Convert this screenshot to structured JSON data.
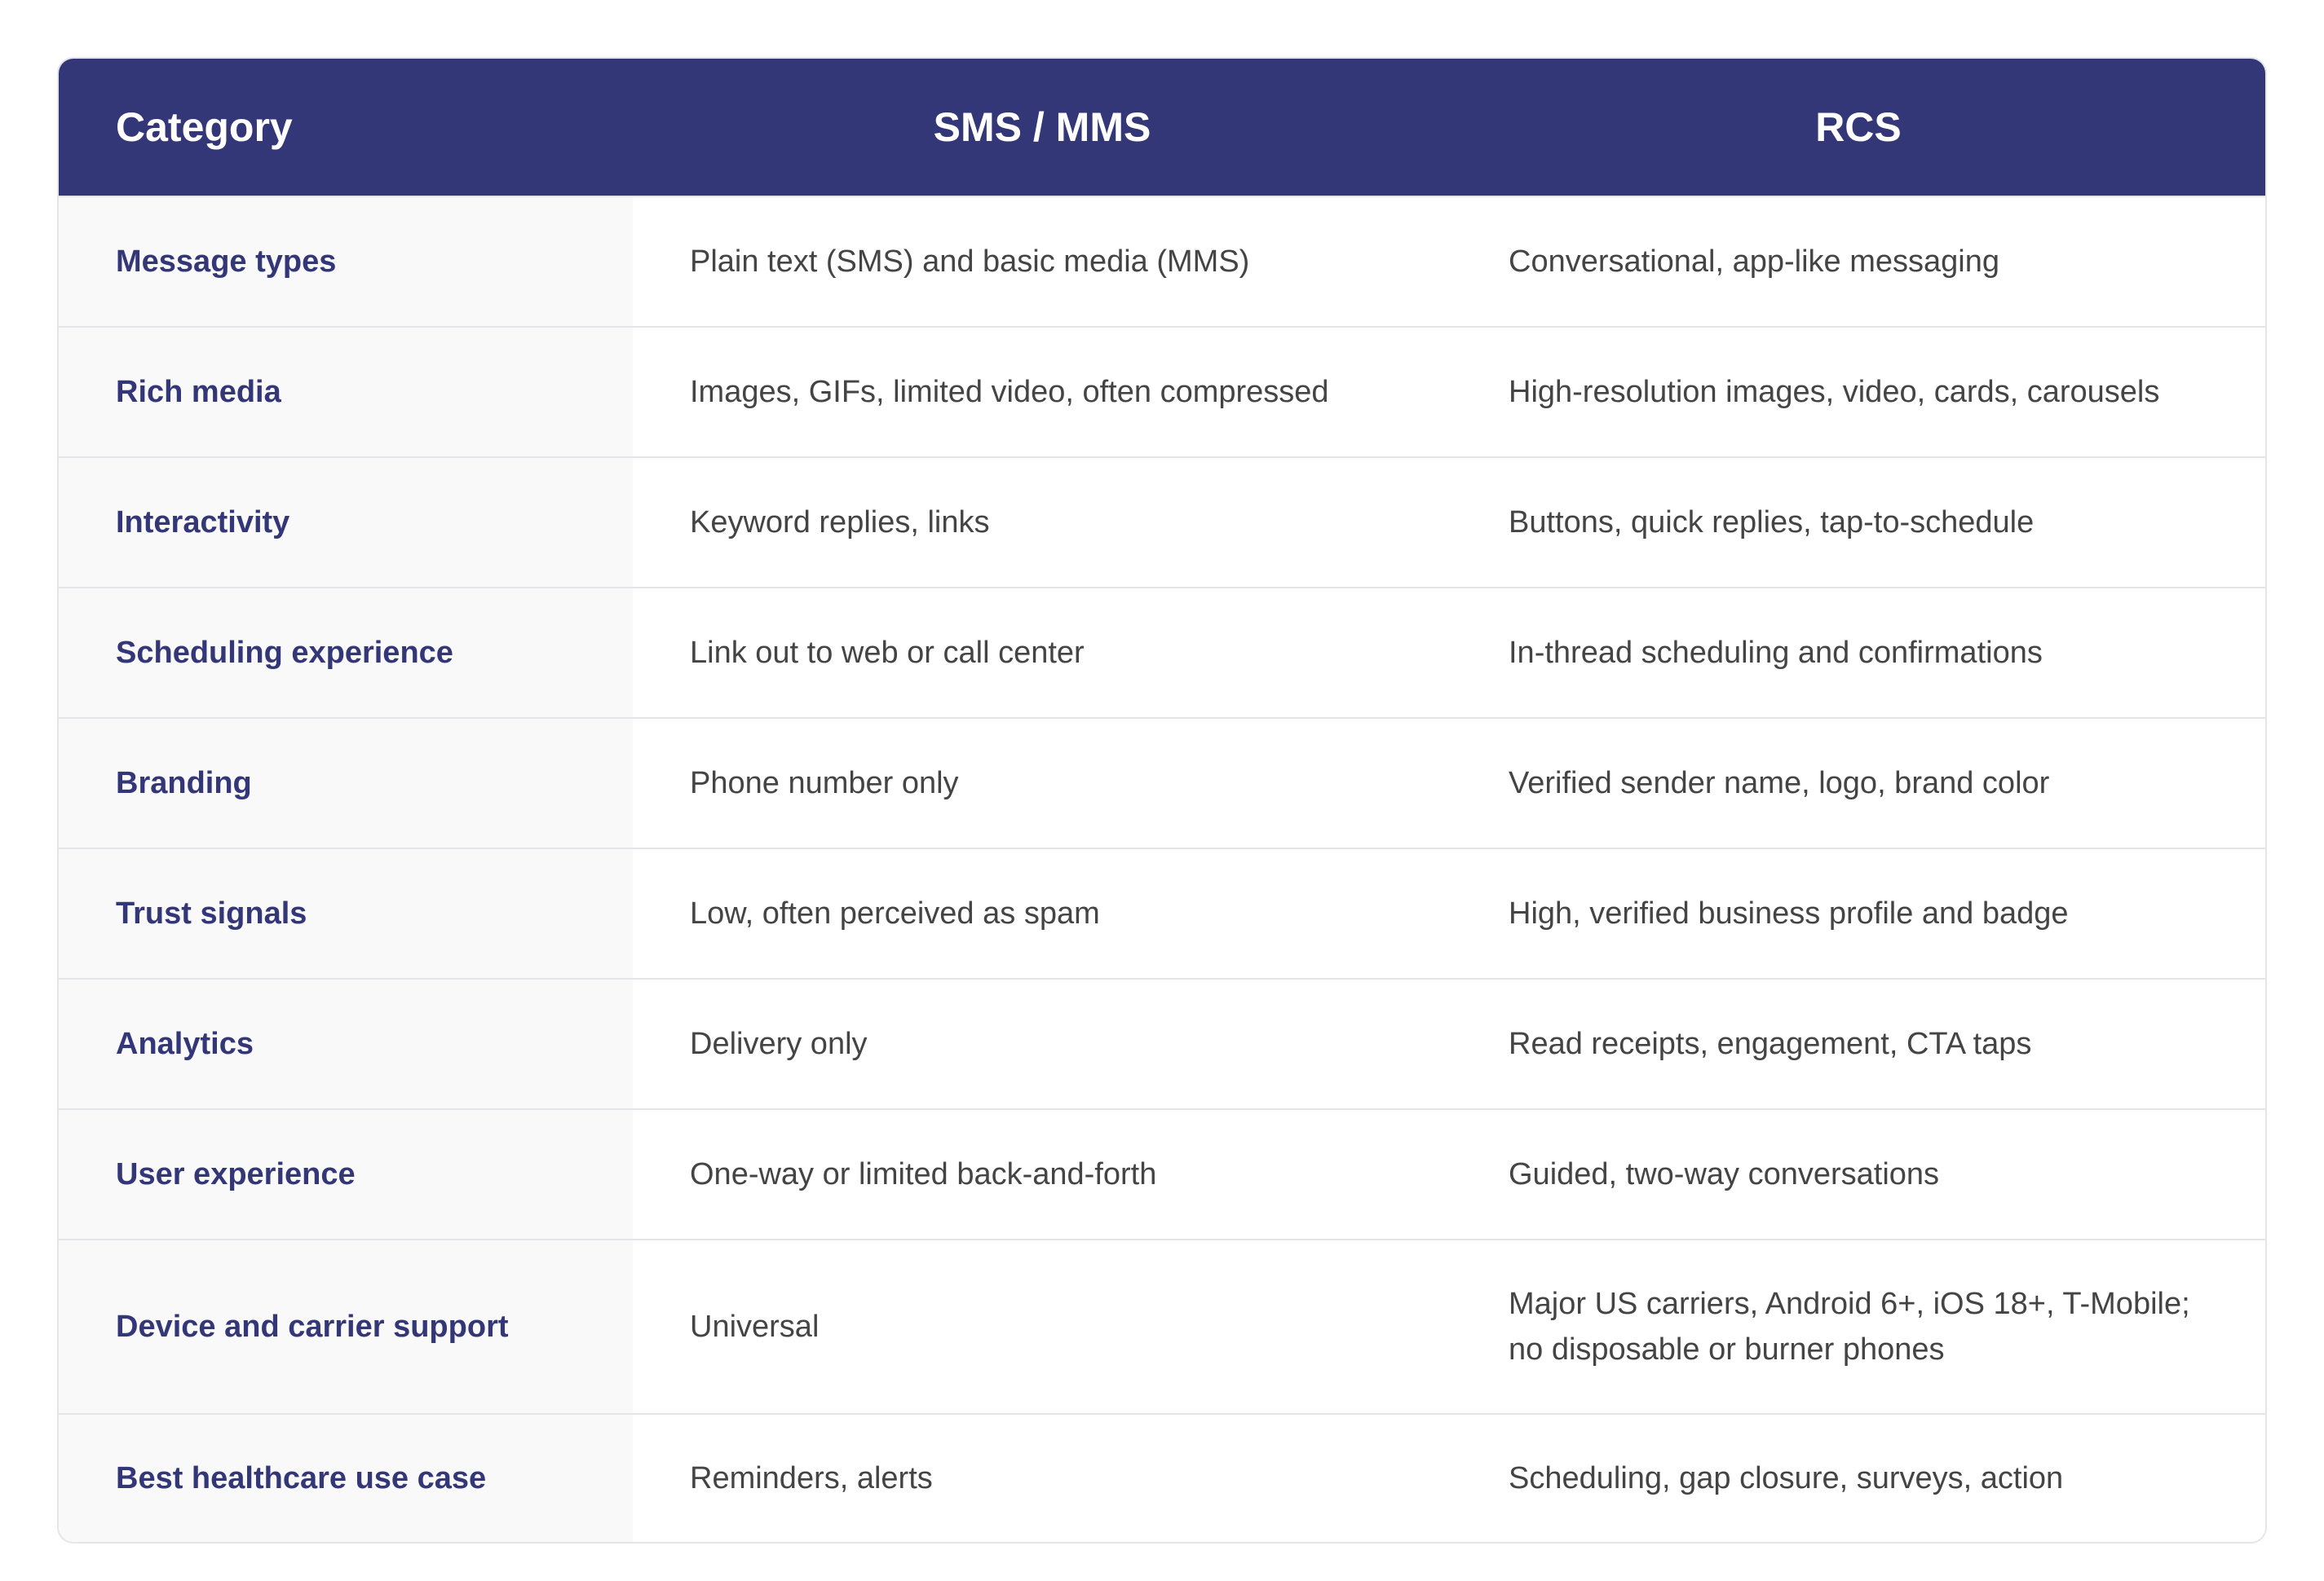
{
  "table": {
    "headers": {
      "category": "Category",
      "sms": "SMS / MMS",
      "rcs": "RCS"
    },
    "rows": [
      {
        "category": "Message types",
        "sms": "Plain text (SMS) and basic media (MMS)",
        "rcs": "Conversational, app-like messaging"
      },
      {
        "category": "Rich media",
        "sms": "Images, GIFs, limited video, often compressed",
        "rcs": "High-resolution images, video, cards, carousels"
      },
      {
        "category": "Interactivity",
        "sms": "Keyword replies, links",
        "rcs": "Buttons, quick replies, tap-to-schedule"
      },
      {
        "category": "Scheduling experience",
        "sms": "Link out to web or call center",
        "rcs": "In-thread scheduling and confirmations"
      },
      {
        "category": "Branding",
        "sms": "Phone number only",
        "rcs": "Verified sender name, logo, brand color"
      },
      {
        "category": "Trust signals",
        "sms": "Low, often perceived as spam",
        "rcs": "High, verified business profile and badge"
      },
      {
        "category": "Analytics",
        "sms": "Delivery only",
        "rcs": "Read receipts, engagement, CTA taps"
      },
      {
        "category": "User experience",
        "sms": "One-way or limited back-and-forth",
        "rcs": "Guided, two-way conversations"
      },
      {
        "category": "Device and carrier support",
        "sms": "Universal",
        "rcs": "Major US carriers, Android 6+, iOS 18+, T-Mobile; no disposable or burner phones"
      },
      {
        "category": "Best healthcare use case",
        "sms": "Reminders, alerts",
        "rcs": "Scheduling, gap closure, surveys, action"
      }
    ]
  },
  "colors": {
    "header_bg": "#343777",
    "header_text": "#ffffff",
    "category_text": "#343777",
    "body_text": "#444444",
    "category_bg": "#f9f9f9",
    "border": "#e4e4e8"
  }
}
